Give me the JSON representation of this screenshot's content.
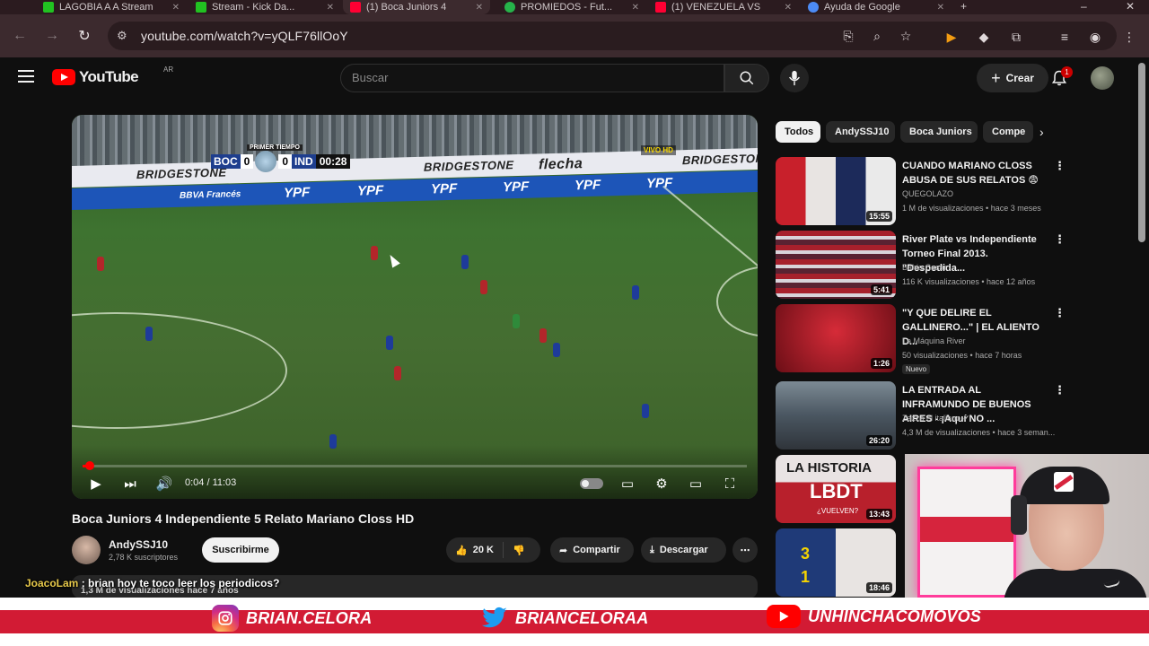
{
  "browser": {
    "tabs": [
      {
        "label": "LAGOBIA A A Stream",
        "color": "#21c221"
      },
      {
        "label": "Stream - Kick Da...",
        "color": "#21c221"
      },
      {
        "label": "(1) Boca Juniors 4",
        "color": "#ff0033"
      },
      {
        "label": "PROMIEDOS - Fut...",
        "color": "#26b34a"
      },
      {
        "label": "(1) VENEZUELA VS",
        "color": "#ff0033"
      },
      {
        "label": "Ayuda de Google",
        "color": "#4c8bf5"
      }
    ],
    "url": "youtube.com/watch?v=yQLF76llOoY"
  },
  "youtube": {
    "logo": "YouTube",
    "country": "AR",
    "search_placeholder": "Buscar",
    "create_label": "Crear",
    "notifications": "1"
  },
  "player": {
    "scorebug": {
      "period": "PRIMER TIEMPO",
      "home": "BOC",
      "home_score": "0",
      "away_score": "0",
      "away": "IND",
      "clock": "00:28",
      "live": "VIVO HD"
    },
    "banner_ads": [
      "BRIDGESTONE",
      "BRIDGESTONE",
      "flecha",
      "BRIDGESTONE"
    ],
    "pitch_ads": [
      "YPF",
      "YPF",
      "YPF",
      "YPF",
      "YPF",
      "YPF"
    ],
    "bank_ad": "BBVA Francés",
    "time": "0:04 / 11:03",
    "progress": 0.006
  },
  "video": {
    "title": "Boca Juniors 4 Independiente 5 Relato Mariano Closs HD",
    "channel": "AndySSJ10",
    "subscribers": "2,78 K suscriptores",
    "subscribe_label": "Suscribirme",
    "likes": "20 K",
    "share_label": "Compartir",
    "download_label": "Descargar",
    "views_line": "1,3 M de visualizaciones  hace 7 años"
  },
  "chat": {
    "user": "JoacoLam",
    "message": ": brian hoy te toco leer los periodicos?"
  },
  "chips": [
    "Todos",
    "AndySSJ10",
    "Boca Juniors",
    "Compe"
  ],
  "related": [
    {
      "title": "CUANDO MARIANO CLOSS ABUSA DE SUS RELATOS 😨",
      "channel": "QUEGOLAZO",
      "meta": "1 M de visualizaciones • hace 3 meses",
      "duration": "15:55",
      "thumb": "#8a1a22"
    },
    {
      "title": "River Plate vs Independiente Torneo Final 2013. \"Despedida...",
      "channel": "Bahia Cesar",
      "meta": "116 K visualizaciones • hace 12 años",
      "duration": "5:41",
      "thumb": "#6b2a3a"
    },
    {
      "title": "\"Y QUE DELIRE EL GALLINERO...\" | EL ALIENTO D...",
      "channel": "La Máquina River",
      "meta": "50 visualizaciones • hace 7 horas",
      "duration": "1:26",
      "thumb": "#9b1b25",
      "badge": "Nuevo"
    },
    {
      "title": "LA ENTRADA AL INFRAMUNDO DE BUENOS AIRES - ¡Aquí NO ...",
      "channel": "Zazza el italiano ✔",
      "meta": "4,3 M de visualizaciones • hace 3 seman...",
      "duration": "26:20",
      "thumb": "#4a5661"
    },
    {
      "title": "",
      "channel": "",
      "meta": "",
      "duration": "13:43",
      "thumb": "#b8202c",
      "thumb_text": "LA HISTORIA",
      "thumb_text2": "LBDT",
      "thumb_text3": "¿VUELVEN?"
    },
    {
      "title": "",
      "channel": "",
      "meta": "",
      "duration": "18:46",
      "thumb": "#1f3a78",
      "thumb_text": "3",
      "thumb_text2": "1"
    }
  ],
  "social": {
    "instagram": "BRIAN.CELORA",
    "twitter": "BRIANCELORAA",
    "youtube": "UNHINCHACOMOVOS"
  }
}
